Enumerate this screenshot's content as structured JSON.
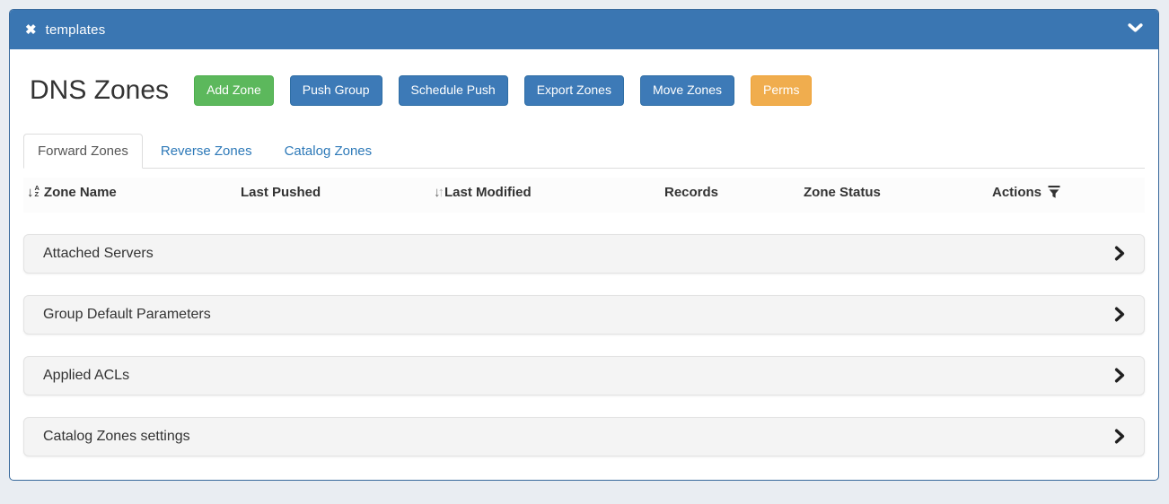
{
  "window": {
    "title": "templates",
    "close_glyph": "✖"
  },
  "page": {
    "title": "DNS Zones"
  },
  "toolbar": {
    "buttons": [
      {
        "label": "Add Zone",
        "style": "success"
      },
      {
        "label": "Push Group",
        "style": "primary"
      },
      {
        "label": "Schedule Push",
        "style": "primary"
      },
      {
        "label": "Export Zones",
        "style": "primary"
      },
      {
        "label": "Move Zones",
        "style": "primary"
      },
      {
        "label": "Perms",
        "style": "warning"
      }
    ]
  },
  "tabs": [
    {
      "label": "Forward Zones",
      "active": true
    },
    {
      "label": "Reverse Zones",
      "active": false
    },
    {
      "label": "Catalog Zones",
      "active": false
    }
  ],
  "table": {
    "columns": [
      {
        "label": "Zone Name",
        "sort_icon": "sort-alpha-down"
      },
      {
        "label": "Last Pushed",
        "sort_icon": "none"
      },
      {
        "label": "Last Modified",
        "sort_icon": "sort-up-down"
      },
      {
        "label": "Records",
        "sort_icon": "none"
      },
      {
        "label": "Zone Status",
        "sort_icon": "none"
      },
      {
        "label": "Actions",
        "filter_icon": "funnel"
      }
    ],
    "rows": []
  },
  "accordions": [
    {
      "label": "Attached Servers",
      "state": "collapsed",
      "icon": "chevron-right"
    },
    {
      "label": "Group Default Parameters",
      "state": "collapsed",
      "icon": "chevron-right"
    },
    {
      "label": "Applied ACLs",
      "state": "collapsed",
      "icon": "chevron-right"
    },
    {
      "label": "Catalog Zones settings",
      "state": "collapsed",
      "icon": "chevron-right"
    }
  ],
  "icons": {
    "header_close": "x-close",
    "header_collapse": "chevron-down"
  },
  "colors": {
    "header_bg": "#3a76b2",
    "page_bg": "#e9edf2",
    "panel_border": "#38699c",
    "btn_success": "#5cb85c",
    "btn_primary": "#3d7ab7",
    "btn_warning": "#f0ad4e",
    "tab_link": "#2d79b8",
    "accordion_bg": "#f4f4f4"
  }
}
